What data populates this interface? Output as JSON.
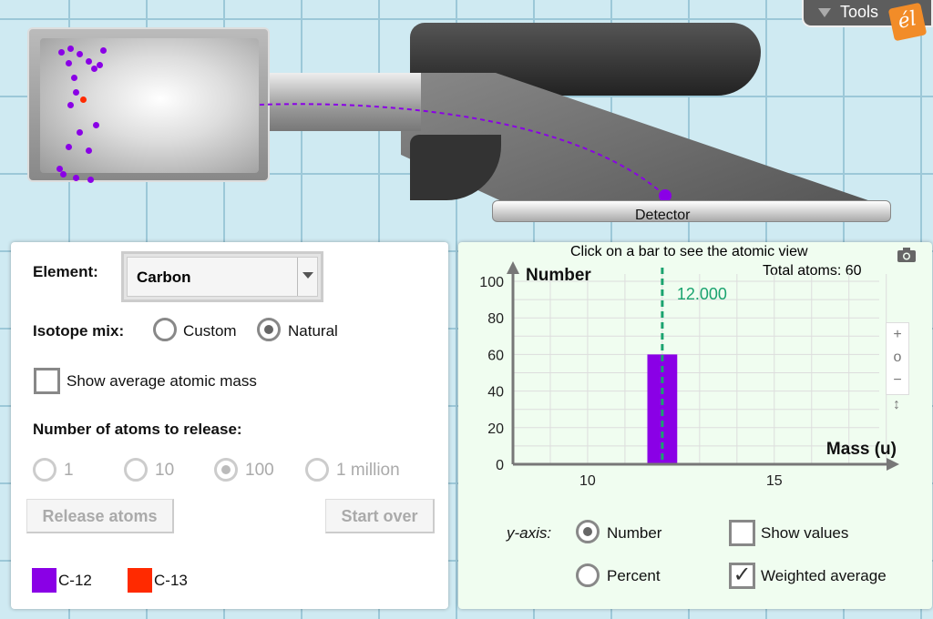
{
  "tools": {
    "label": "Tools",
    "logo": "el"
  },
  "apparatus": {
    "detector_label": "Detector",
    "colors": {
      "c12": "#8a00e6",
      "c13": "#ff2a00"
    }
  },
  "controls": {
    "element_label": "Element:",
    "element_value": "Carbon",
    "isotope_label": "Isotope mix:",
    "isotope_options": [
      {
        "label": "Custom",
        "selected": false
      },
      {
        "label": "Natural",
        "selected": true
      }
    ],
    "show_avg_label": "Show average atomic mass",
    "show_avg_checked": false,
    "release_label": "Number of atoms to release:",
    "release_options": [
      {
        "label": "1",
        "selected": false
      },
      {
        "label": "10",
        "selected": false
      },
      {
        "label": "100",
        "selected": true
      },
      {
        "label": "1 million",
        "selected": false
      }
    ],
    "release_button": "Release atoms",
    "start_over_button": "Start over",
    "legend": [
      {
        "label": "C-12",
        "color": "#8a00e6"
      },
      {
        "label": "C-13",
        "color": "#ff2a00"
      }
    ]
  },
  "graph": {
    "hint": "Click on a bar to see the atomic view",
    "total_label": "Total atoms:",
    "total_value": "60",
    "zoom_in": "+",
    "zoom_reset": "o",
    "zoom_out": "−",
    "scale": "↕",
    "yaxis_label": "y-axis:",
    "yaxis_options": [
      {
        "label": "Number",
        "selected": true
      },
      {
        "label": "Percent",
        "selected": false
      }
    ],
    "show_values_label": "Show values",
    "show_values_checked": false,
    "weighted_label": "Weighted average",
    "weighted_checked": true
  },
  "chart_data": {
    "type": "bar",
    "ylabel": "Number",
    "xlabel": "Mass (u)",
    "xlim": [
      8,
      18.3
    ],
    "ylim": [
      0,
      100
    ],
    "yticks": [
      "0",
      "20",
      "40",
      "60",
      "80",
      "100"
    ],
    "xticks": [
      "10",
      "15"
    ],
    "grid": true,
    "bars": [
      {
        "x": 12,
        "value": 60,
        "color": "#8a00e6"
      }
    ],
    "weighted_average": {
      "value": 12.0,
      "label": "12.000",
      "color": "#1aa36f"
    }
  }
}
